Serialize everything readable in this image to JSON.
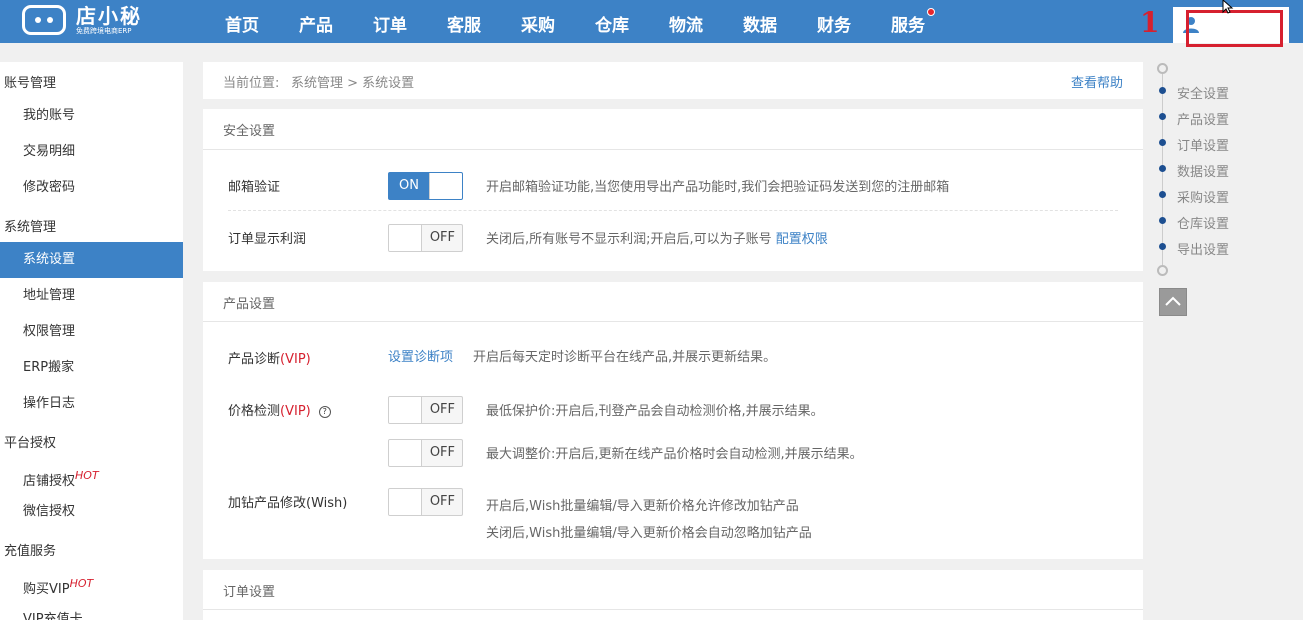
{
  "colors": {
    "primary": "#3d82c6",
    "accent_red": "#d6202f",
    "toc_dot": "#1d4f91"
  },
  "header": {
    "logo_title": "店小秘",
    "logo_subtitle": "免费跨境电商ERP",
    "nav": [
      "首页",
      "产品",
      "订单",
      "客服",
      "采购",
      "仓库",
      "物流",
      "数据",
      "财务",
      "服务"
    ],
    "annotation_number": "1",
    "icons": {
      "user": "user-icon",
      "cursor": "mouse-cursor-icon"
    }
  },
  "sidebar": {
    "groups": [
      {
        "title": "账号管理",
        "items": [
          {
            "label": "我的账号"
          },
          {
            "label": "交易明细"
          },
          {
            "label": "修改密码"
          }
        ]
      },
      {
        "title": "系统管理",
        "items": [
          {
            "label": "系统设置",
            "active": true
          },
          {
            "label": "地址管理"
          },
          {
            "label": "权限管理"
          },
          {
            "label": "ERP搬家"
          },
          {
            "label": "操作日志"
          }
        ]
      },
      {
        "title": "平台授权",
        "items": [
          {
            "label": "店铺授权",
            "badge": "HOT"
          },
          {
            "label": "微信授权"
          }
        ]
      },
      {
        "title": "充值服务",
        "items": [
          {
            "label": "购买VIP",
            "badge": "HOT"
          },
          {
            "label": "VIP充值卡"
          }
        ]
      }
    ]
  },
  "breadcrumb": {
    "label": "当前位置:",
    "path": "系统管理 > 系统设置",
    "help": "查看帮助"
  },
  "sections": {
    "security": {
      "title": "安全设置",
      "rows": [
        {
          "label": "邮箱验证",
          "toggle": "ON",
          "desc": "开启邮箱验证功能,当您使用导出产品功能时,我们会把验证码发送到您的注册邮箱"
        },
        {
          "label": "订单显示利润",
          "toggle": "OFF",
          "desc": "关闭后,所有账号不显示利润;开启后,可以为子账号",
          "desc_link": "配置权限"
        }
      ]
    },
    "product": {
      "title": "产品设置",
      "diagnosis": {
        "label": "产品诊断",
        "vip": "(VIP)",
        "link": "设置诊断项",
        "desc": "开启后每天定时诊断平台在线产品,并展示更新结果。"
      },
      "price_check": {
        "label": "价格检测",
        "vip": "(VIP)",
        "help_icon": "?",
        "rows": [
          {
            "toggle": "OFF",
            "desc": "最低保护价:开启后,刊登产品会自动检测价格,并展示结果。"
          },
          {
            "toggle": "OFF",
            "desc": "最大调整价:开启后,更新在线产品价格时会自动检测,并展示结果。"
          }
        ]
      },
      "diamond": {
        "label": "加钻产品修改(Wish)",
        "toggle": "OFF",
        "desc1": "开启后,Wish批量编辑/导入更新价格允许修改加钻产品",
        "desc2": "关闭后,Wish批量编辑/导入更新价格会自动忽略加钻产品"
      }
    },
    "order": {
      "title": "订单设置"
    }
  },
  "toc": {
    "items": [
      "安全设置",
      "产品设置",
      "订单设置",
      "数据设置",
      "采购设置",
      "仓库设置",
      "导出设置"
    ],
    "back_to_top": "chevron-up-icon"
  }
}
